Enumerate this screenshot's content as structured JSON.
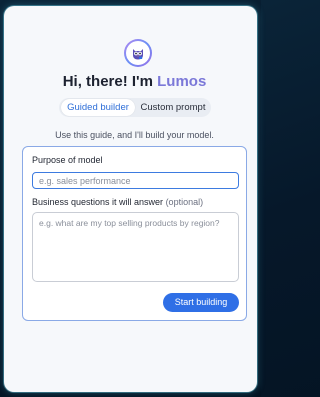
{
  "header": {
    "greeting_prefix": "Hi, there! I'm ",
    "brand_name": "Lumos",
    "avatar_icon": "owl-icon"
  },
  "tabs": [
    {
      "label": "Guided builder",
      "active": true
    },
    {
      "label": "Custom prompt",
      "active": false
    }
  ],
  "helper_text": "Use this guide, and I'll build your model.",
  "form": {
    "purpose": {
      "label": "Purpose of model",
      "placeholder": "e.g. sales performance",
      "value": ""
    },
    "questions": {
      "label": "Business questions it will answer",
      "label_optional": " (optional)",
      "placeholder": "e.g. what are my top selling products by region?",
      "value": ""
    },
    "submit_label": "Start building"
  },
  "colors": {
    "brand": "#7b78d8",
    "accent": "#2f6fe6",
    "background": "#06182a"
  }
}
